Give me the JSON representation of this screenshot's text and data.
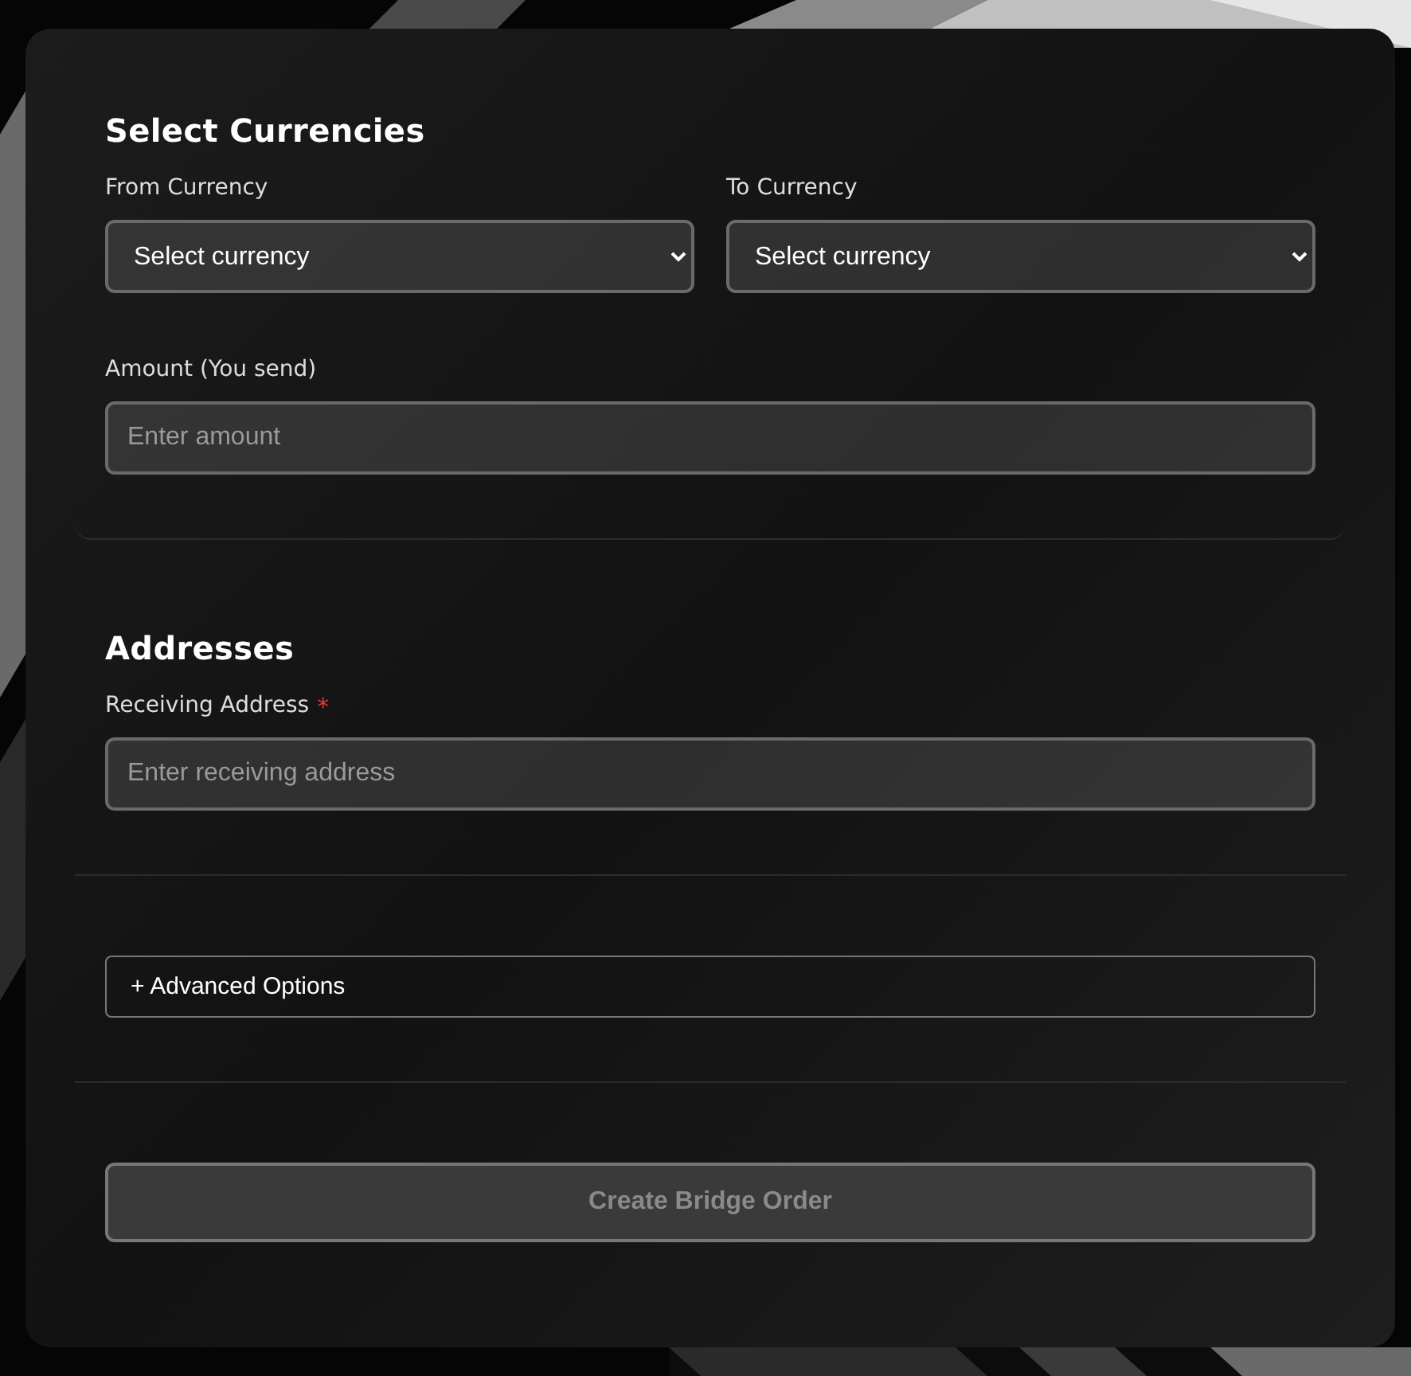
{
  "currency_section": {
    "title": "Select Currencies",
    "from_currency": {
      "label": "From Currency",
      "value": "Select currency"
    },
    "to_currency": {
      "label": "To Currency",
      "value": "Select currency"
    },
    "amount": {
      "label": "Amount (You send)",
      "placeholder": "Enter amount"
    }
  },
  "address_section": {
    "title": "Addresses",
    "receiving_address": {
      "label": "Receiving Address",
      "required_mark": "*",
      "placeholder": "Enter receiving address"
    }
  },
  "advanced_options": {
    "label": "+ Advanced Options",
    "expanded": false
  },
  "submit": {
    "label": "Create Bridge Order",
    "disabled": true
  }
}
